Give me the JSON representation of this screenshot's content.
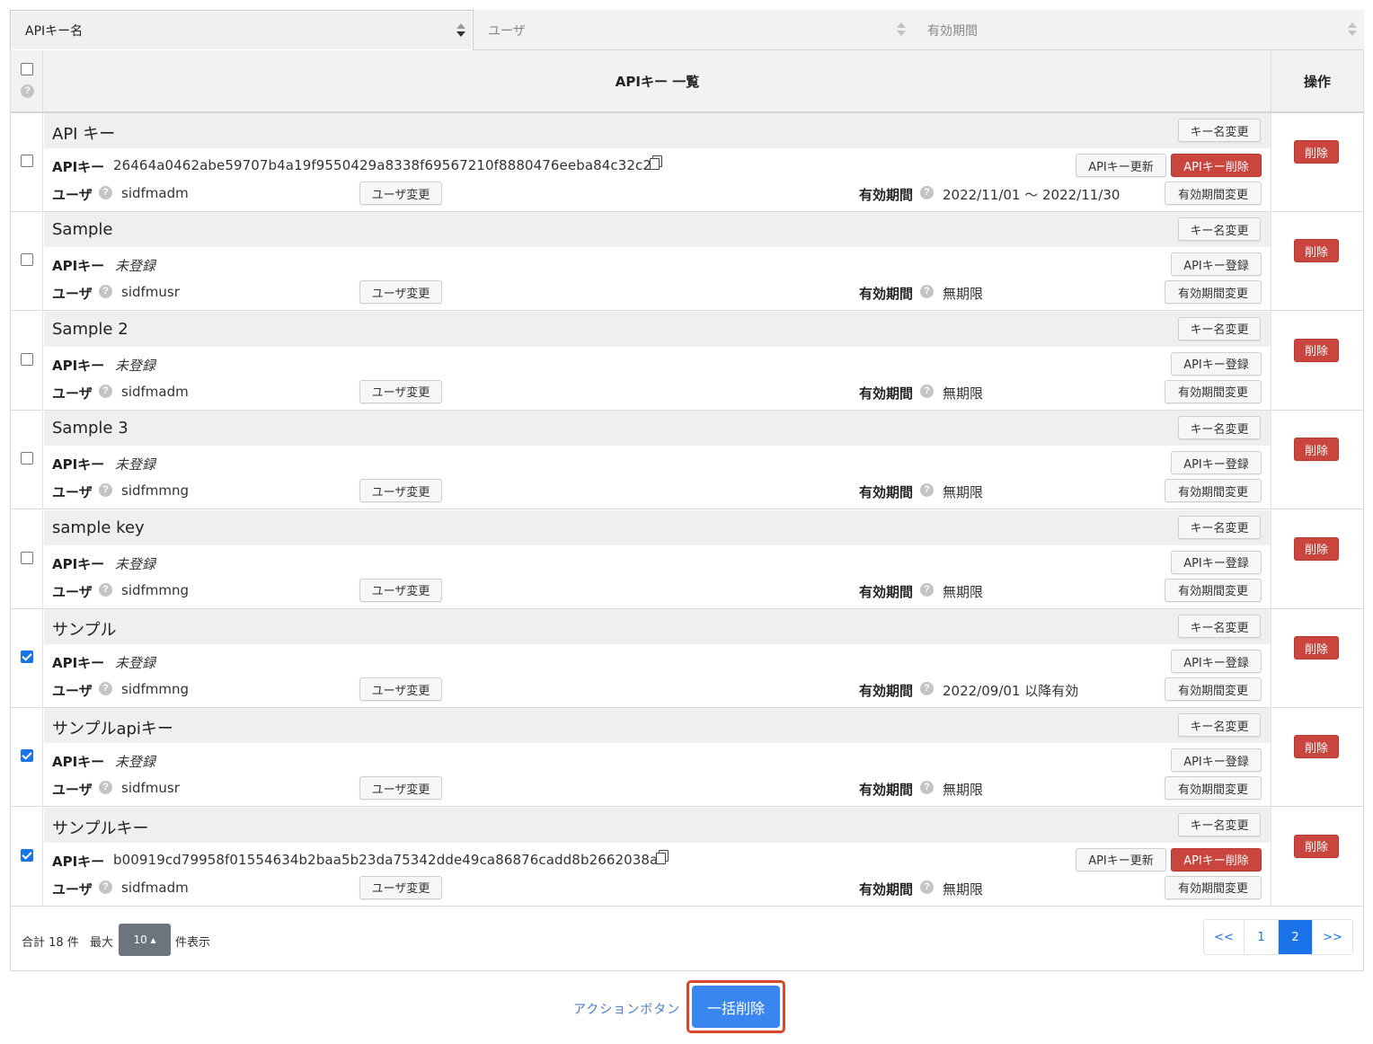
{
  "sort": {
    "columns": [
      {
        "label": "APIキー名"
      },
      {
        "label": "ユーザ"
      },
      {
        "label": "有効期間"
      }
    ]
  },
  "table": {
    "title": "APIキー 一覧",
    "ops_header": "操作",
    "labels": {
      "apikey": "APIキー",
      "user": "ユーザ",
      "period": "有効期間"
    },
    "buttons": {
      "rename": "キー名変更",
      "user_change": "ユーザ変更",
      "period_change": "有効期間変更",
      "key_update": "APIキー更新",
      "key_delete": "APIキー削除",
      "key_register": "APIキー登録",
      "delete": "削除"
    },
    "rows": [
      {
        "name": "API キー",
        "checked": false,
        "apikey": "26464a0462abe59707b4a19f9550429a8338f69567210f8880476eeba84c32c2",
        "registered": true,
        "user": "sidfmadm",
        "period": "2022/11/01 〜 2022/11/30"
      },
      {
        "name": "Sample",
        "checked": false,
        "apikey": "未登録",
        "registered": false,
        "user": "sidfmusr",
        "period": "無期限"
      },
      {
        "name": "Sample 2",
        "checked": false,
        "apikey": "未登録",
        "registered": false,
        "user": "sidfmadm",
        "period": "無期限"
      },
      {
        "name": "Sample 3",
        "checked": false,
        "apikey": "未登録",
        "registered": false,
        "user": "sidfmmng",
        "period": "無期限"
      },
      {
        "name": "sample key",
        "checked": false,
        "apikey": "未登録",
        "registered": false,
        "user": "sidfmmng",
        "period": "無期限"
      },
      {
        "name": "サンプル",
        "checked": true,
        "apikey": "未登録",
        "registered": false,
        "user": "sidfmmng",
        "period": "2022/09/01 以降有効"
      },
      {
        "name": "サンプルapiキー",
        "checked": true,
        "apikey": "未登録",
        "registered": false,
        "user": "sidfmusr",
        "period": "無期限"
      },
      {
        "name": "サンプルキー",
        "checked": true,
        "apikey": "b00919cd79958f01554634b2baa5b23da75342dde49ca86876cadd8b2662038a",
        "registered": true,
        "user": "sidfmadm",
        "period": "無期限"
      }
    ]
  },
  "footer": {
    "total_prefix": "合計 18 件",
    "max_label": "最大",
    "per_page": "10 ▴",
    "suffix": "件表示",
    "pager": [
      "<<",
      "1",
      "2",
      ">>"
    ],
    "active_page": "2"
  },
  "actions": {
    "label": "アクションボタン",
    "bulk_delete": "一括削除"
  },
  "colors": {
    "accent": "#1a73e8",
    "danger": "#c9453d",
    "highlight_outline": "#d9472b"
  }
}
